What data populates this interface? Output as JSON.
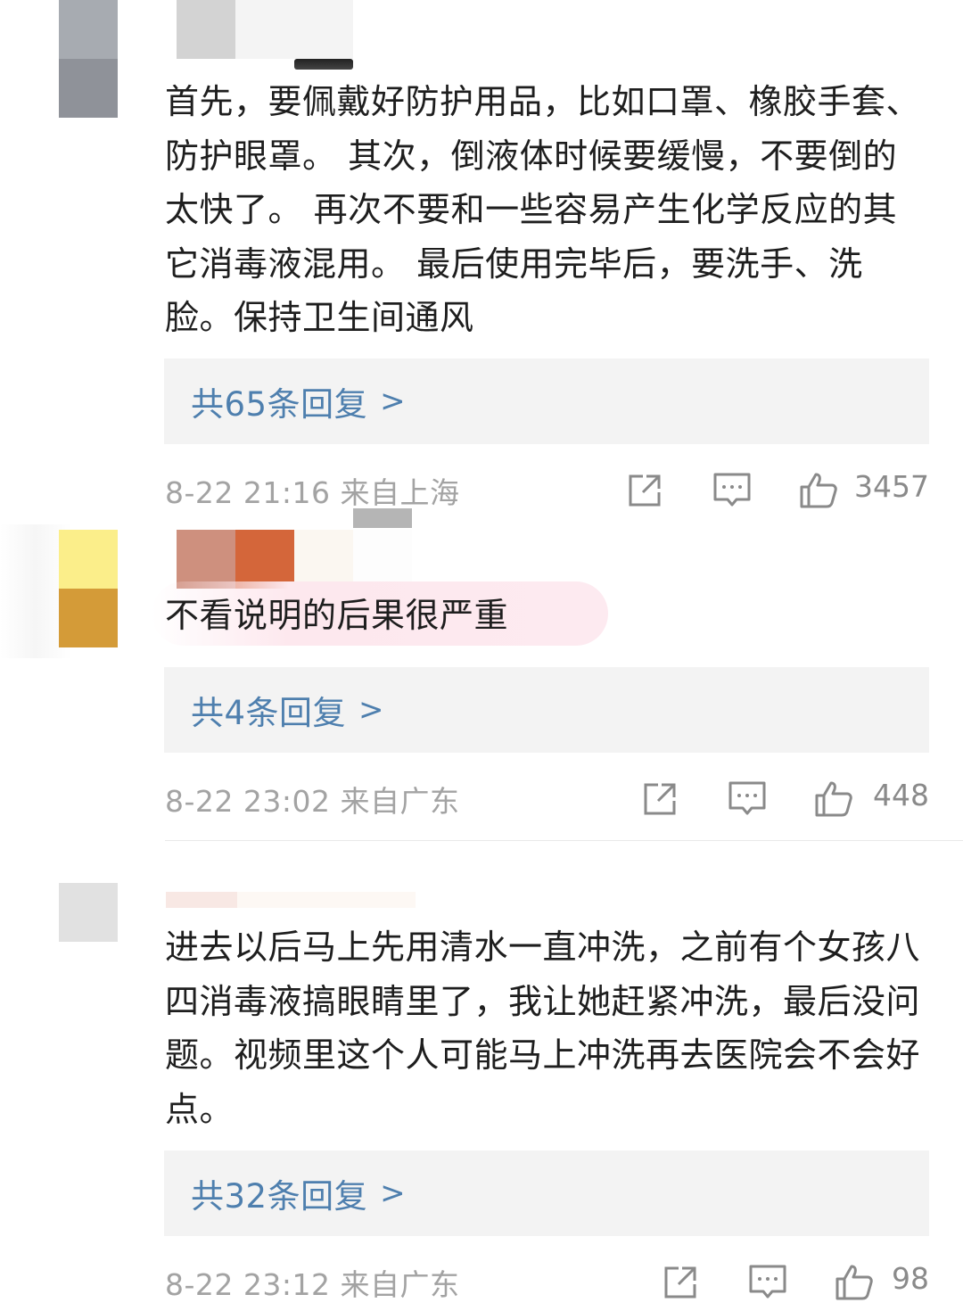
{
  "comments": [
    {
      "avatar_colors": [
        "#a7abb1",
        "#8f9299"
      ],
      "name_colors": [
        "#d3d3d3",
        "#ececec"
      ],
      "text": "首先，要佩戴好防护用品，比如口罩、橡胶手套、防护眼罩。 其次，倒液体时候要缓慢，不要倒的太快了。 再次不要和一些容易产生化学反应的其它消毒液混用。 最后使用完毕后，要洗手、洗脸。保持卫生间通风",
      "replies": "共65条回复",
      "chevron": ">",
      "time": "8-22 21:16 来自上海",
      "likes": "3457"
    },
    {
      "avatar_colors": [
        "#fbee8a",
        "#d49b38"
      ],
      "name_colors": [
        "#ce907e",
        "#d4663a"
      ],
      "text": "不看说明的后果很严重",
      "replies": "共4条回复",
      "chevron": ">",
      "time": "8-22 23:02 来自广东",
      "likes": "448"
    },
    {
      "avatar_colors": [
        "#e1e1e1",
        "#e6e6e6"
      ],
      "name_colors": [
        "#f6e4de",
        "#fbf1e8"
      ],
      "text": "进去以后马上先用清水一直冲洗，之前有个女孩八四消毒液搞眼睛里了，我让她赶紧冲洗，最后没问题。视频里这个人可能马上冲洗再去医院会不会好点。",
      "replies": "共32条回复",
      "chevron": ">",
      "time": "8-22 23:12 来自广东",
      "likes": "98"
    }
  ],
  "icons": {
    "share": "share-icon",
    "comment": "comment-icon",
    "like": "thumbs-up-icon"
  },
  "colors": {
    "reply_link": "#4e7fae",
    "reply_bg": "#f3f3f3",
    "meta_text": "#a3a3a3",
    "highlight": "#fde8ee"
  }
}
